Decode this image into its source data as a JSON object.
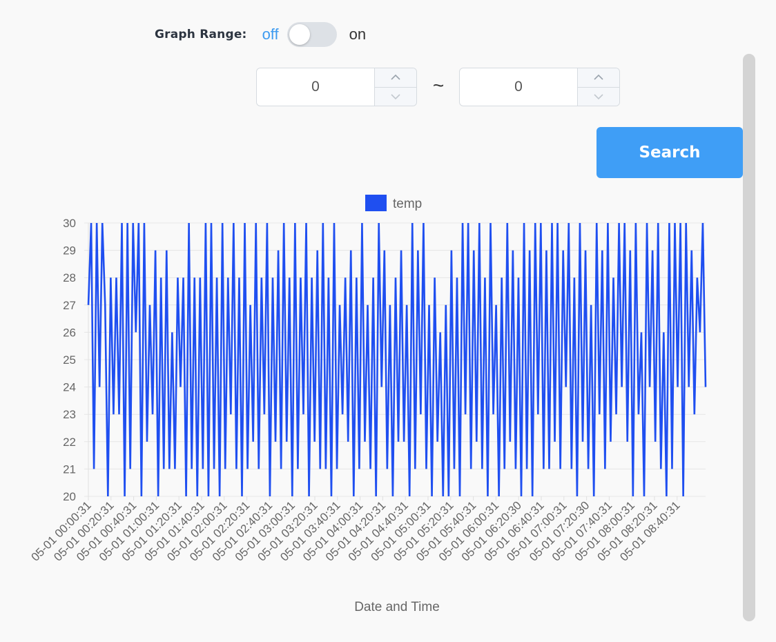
{
  "graph_range": {
    "label": "Graph Range:",
    "off_label": "off",
    "on_label": "on",
    "enabled": false
  },
  "range_inputs": {
    "from_value": "0",
    "to_value": "0",
    "separator": "~"
  },
  "search_button": {
    "label": "Search"
  },
  "colors": {
    "accent": "#3f9ef6",
    "line": "#1f4ff0",
    "off_text": "#3d9bf0",
    "toggle_track": "#dde1e6"
  },
  "icons": [
    "chevron-up-icon",
    "chevron-down-icon"
  ],
  "chart_data": {
    "type": "line",
    "xlabel": "Date and Time",
    "ylabel": "",
    "ylim": [
      20,
      30
    ],
    "y_ticks": [
      "20",
      "21",
      "22",
      "23",
      "24",
      "25",
      "26",
      "27",
      "28",
      "29",
      "30"
    ],
    "x_tick_labels": [
      "05-01 00:00:31",
      "05-01 00:20:31",
      "05-01 00:40:31",
      "05-01 01:00:31",
      "05-01 01:20:31",
      "05-01 01:40:31",
      "05-01 02:00:31",
      "05-01 02:20:31",
      "05-01 02:40:31",
      "05-01 03:00:31",
      "05-01 03:20:31",
      "05-01 03:40:31",
      "05-01 04:00:31",
      "05-01 04:20:31",
      "05-01 04:40:31",
      "05-01 05:00:31",
      "05-01 05:20:31",
      "05-01 05:40:31",
      "05-01 06:00:31",
      "05-01 06:20:30",
      "05-01 06:40:31",
      "05-01 07:00:31",
      "05-01 07:20:30",
      "05-01 07:40:31",
      "05-01 08:00:31",
      "05-01 08:20:31",
      "05-01 08:40:31"
    ],
    "grid": true,
    "legend_position": "top-center",
    "series": [
      {
        "name": "temp",
        "values": [
          27,
          30,
          21,
          30,
          24,
          30,
          27,
          20,
          28,
          23,
          28,
          23,
          30,
          20,
          30,
          21,
          30,
          26,
          30,
          20,
          30,
          22,
          27,
          23,
          29,
          20,
          28,
          21,
          29,
          21,
          26,
          21,
          28,
          24,
          28,
          20,
          30,
          21,
          28,
          20,
          28,
          21,
          30,
          20,
          30,
          21,
          28,
          20,
          30,
          21,
          28,
          23,
          30,
          21,
          28,
          20,
          30,
          21,
          27,
          22,
          30,
          21,
          28,
          23,
          30,
          20,
          28,
          22,
          29,
          21,
          30,
          22,
          28,
          20,
          30,
          21,
          28,
          23,
          30,
          20,
          28,
          22,
          29,
          21,
          30,
          21,
          28,
          20,
          30,
          21,
          27,
          23,
          28,
          22,
          29,
          20,
          28,
          21,
          30,
          22,
          27,
          21,
          28,
          20,
          30,
          24,
          29,
          21,
          27,
          20,
          28,
          22,
          29,
          22,
          27,
          20,
          30,
          21,
          29,
          23,
          30,
          21,
          27,
          20,
          28,
          22,
          26,
          20,
          27,
          20,
          29,
          21,
          28,
          20,
          30,
          23,
          30,
          21,
          29,
          22,
          30,
          21,
          28,
          20,
          30,
          23,
          27,
          20,
          28,
          21,
          30,
          22,
          29,
          21,
          28,
          20,
          30,
          21,
          29,
          20,
          30,
          23,
          30,
          21,
          29,
          21,
          30,
          22,
          30,
          21,
          29,
          24,
          30,
          21,
          28,
          20,
          30,
          22,
          29,
          21,
          27,
          20,
          30,
          23,
          29,
          21,
          30,
          22,
          28,
          23,
          30,
          24,
          30,
          22,
          29,
          20,
          30,
          23,
          26,
          20,
          30,
          24,
          29,
          22,
          30,
          21,
          26,
          20,
          30,
          21,
          30,
          24,
          30,
          20,
          30,
          24,
          29,
          23,
          28,
          26,
          30,
          24
        ]
      }
    ]
  }
}
